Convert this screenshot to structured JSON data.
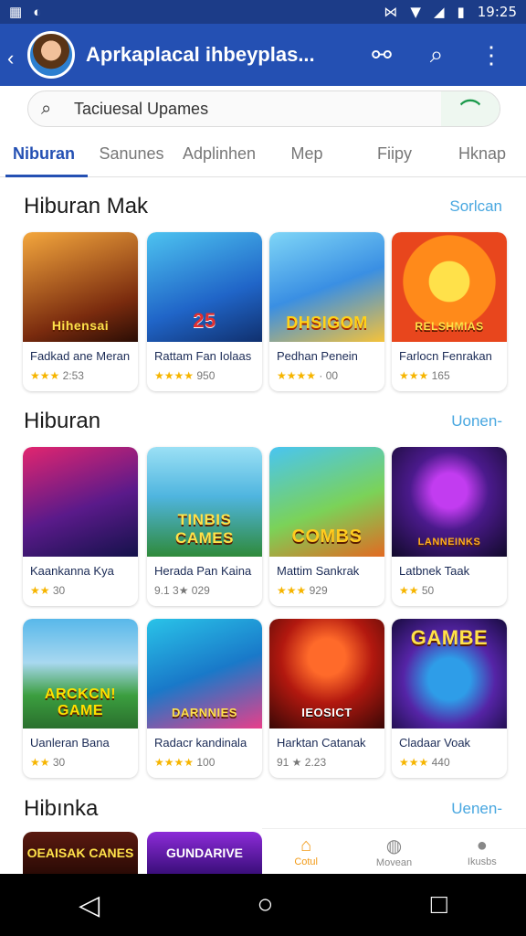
{
  "status_bar": {
    "time": "19:25"
  },
  "app_bar": {
    "title": "Aprkaplacal ihbeyplas..."
  },
  "search": {
    "placeholder": "Taciuesal Upames"
  },
  "tabs": [
    "Niburan",
    "Sanunes",
    "Adplinhen",
    "Mep",
    "Fiipy",
    "Hknap"
  ],
  "sections": [
    {
      "title": "Hiburan Mak",
      "more": "Sorlcan",
      "apps": [
        {
          "thumb": "Hihensai",
          "name": "Fadkad ane Meran",
          "stars": "★★★",
          "meta": "2:53"
        },
        {
          "thumb": "25",
          "name": "Rattam Fan Iolaas",
          "stars": "★★★★",
          "meta": "950"
        },
        {
          "thumb": "DHSIGOM",
          "name": "Pedhan Penein",
          "stars": "★★★★",
          "meta": "· 00"
        },
        {
          "thumb": "RELSHMIAS",
          "name": "Farlocn Fenrakan",
          "stars": "★★★",
          "meta": "165"
        }
      ]
    },
    {
      "title": "Hiburan",
      "more": "Uonen-",
      "apps": [
        {
          "thumb": "",
          "name": "Kaankanna Kya",
          "stars": "★★",
          "meta": "30"
        },
        {
          "thumb": "TINBIS CAMES",
          "name": "Herada Pan Kaina",
          "stars": "9.1 3★",
          "meta": "029"
        },
        {
          "thumb": "COMBS",
          "name": "Mattim Sankrak",
          "stars": "★★★",
          "meta": "929"
        },
        {
          "thumb": "LANNEINKS",
          "name": "Latbnek Taak",
          "stars": "★★",
          "meta": "50"
        }
      ]
    },
    {
      "title": "",
      "more": "",
      "apps": [
        {
          "thumb": "ARCKCN! GAME",
          "name": "Uanleran Bana",
          "stars": "★★",
          "meta": "30"
        },
        {
          "thumb": "DARNNIES",
          "name": "Radacr kandinala",
          "stars": "★★★★",
          "meta": "100"
        },
        {
          "thumb": "IEOSICT",
          "name": "Harktan Catanak",
          "stars": "91 ★",
          "meta": "2.23"
        },
        {
          "thumb": "GAMBE",
          "name": "Cladaar Voak",
          "stars": "★★★",
          "meta": "440"
        }
      ]
    },
    {
      "title": "Hibınka",
      "more": "Uenen-",
      "apps": [
        {
          "thumb": "OEAISAK CANES"
        },
        {
          "thumb": "GUNDARIVE"
        }
      ]
    }
  ],
  "bottom_nav": [
    {
      "label": "Cotul",
      "active": true
    },
    {
      "label": "Movean",
      "active": false
    },
    {
      "label": "Ikusbs",
      "active": false
    }
  ],
  "colors": {
    "primary": "#2450b3",
    "accent": "#48a7e0",
    "star": "#f6b500",
    "nav_active": "#f29a16"
  }
}
